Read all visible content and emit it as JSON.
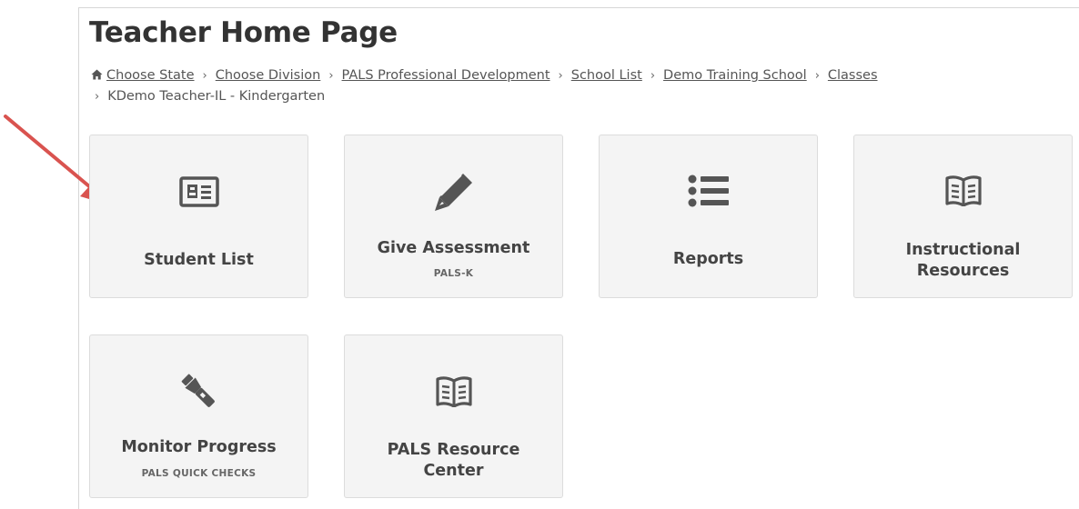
{
  "page": {
    "title": "Teacher Home Page"
  },
  "breadcrumb": {
    "items": [
      "Choose State",
      "Choose Division",
      "PALS Professional Development",
      "School List",
      "Demo Training School",
      "Classes"
    ],
    "current": "KDemo Teacher-IL - Kindergarten"
  },
  "tiles": {
    "student_list": {
      "label": "Student List",
      "icon": "id-card-icon"
    },
    "give_assessment": {
      "label": "Give Assessment",
      "sub": "PALS-K",
      "icon": "pencil-icon"
    },
    "reports": {
      "label": "Reports",
      "icon": "list-icon"
    },
    "instructional_resources": {
      "label_line1": "Instructional",
      "label_line2": "Resources",
      "icon": "book-icon"
    },
    "monitor_progress": {
      "label": "Monitor Progress",
      "sub": "PALS QUICK CHECKS",
      "icon": "flashlight-icon"
    },
    "resource_center": {
      "label_line1": "PALS Resource",
      "label_line2": "Center",
      "icon": "book-icon"
    }
  },
  "colors": {
    "tile_bg": "#f4f4f4",
    "icon": "#555555",
    "arrow": "#d9534f"
  }
}
